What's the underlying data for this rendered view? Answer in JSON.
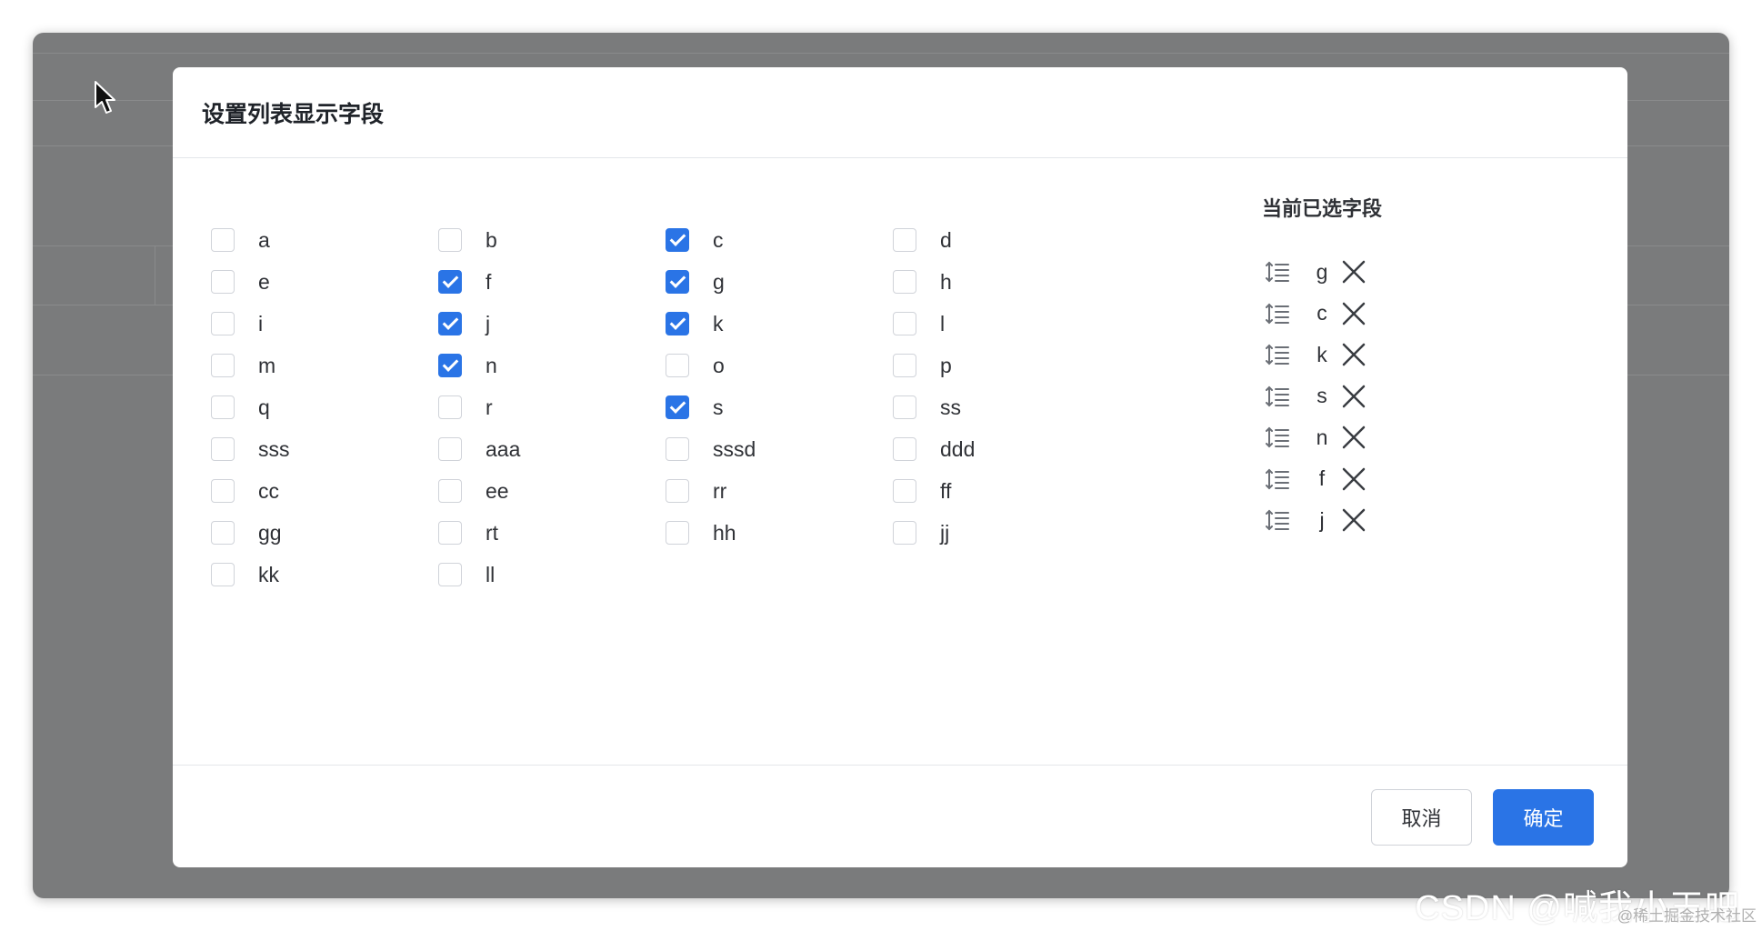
{
  "dialog": {
    "title": "设置列表显示字段",
    "selected_title": "当前已选字段",
    "cancel_label": "取消",
    "ok_label": "确定"
  },
  "checkboxes": [
    {
      "label": "a",
      "checked": false
    },
    {
      "label": "b",
      "checked": false
    },
    {
      "label": "c",
      "checked": true
    },
    {
      "label": "d",
      "checked": false
    },
    {
      "label": "e",
      "checked": false
    },
    {
      "label": "f",
      "checked": true
    },
    {
      "label": "g",
      "checked": true
    },
    {
      "label": "h",
      "checked": false
    },
    {
      "label": "i",
      "checked": false
    },
    {
      "label": "j",
      "checked": true
    },
    {
      "label": "k",
      "checked": true
    },
    {
      "label": "l",
      "checked": false
    },
    {
      "label": "m",
      "checked": false
    },
    {
      "label": "n",
      "checked": true
    },
    {
      "label": "o",
      "checked": false
    },
    {
      "label": "p",
      "checked": false
    },
    {
      "label": "q",
      "checked": false
    },
    {
      "label": "r",
      "checked": false
    },
    {
      "label": "s",
      "checked": true
    },
    {
      "label": "ss",
      "checked": false
    },
    {
      "label": "sss",
      "checked": false
    },
    {
      "label": "aaa",
      "checked": false
    },
    {
      "label": "sssd",
      "checked": false
    },
    {
      "label": "ddd",
      "checked": false
    },
    {
      "label": "cc",
      "checked": false
    },
    {
      "label": "ee",
      "checked": false
    },
    {
      "label": "rr",
      "checked": false
    },
    {
      "label": "ff",
      "checked": false
    },
    {
      "label": "gg",
      "checked": false
    },
    {
      "label": "rt",
      "checked": false
    },
    {
      "label": "hh",
      "checked": false
    },
    {
      "label": "jj",
      "checked": false
    },
    {
      "label": "kk",
      "checked": false
    },
    {
      "label": "ll",
      "checked": false
    }
  ],
  "selected_fields": [
    "g",
    "c",
    "k",
    "s",
    "n",
    "f",
    "j"
  ],
  "icons": {
    "drag": "drag-sort-icon",
    "remove": "close-icon",
    "cursor": "mouse-pointer-icon"
  },
  "colors": {
    "primary": "#2a74e6",
    "overlay": "#7a7b7c"
  },
  "watermark": {
    "main": "CSDN @喊我小王吧",
    "sub": "@稀土掘金技术社区"
  }
}
